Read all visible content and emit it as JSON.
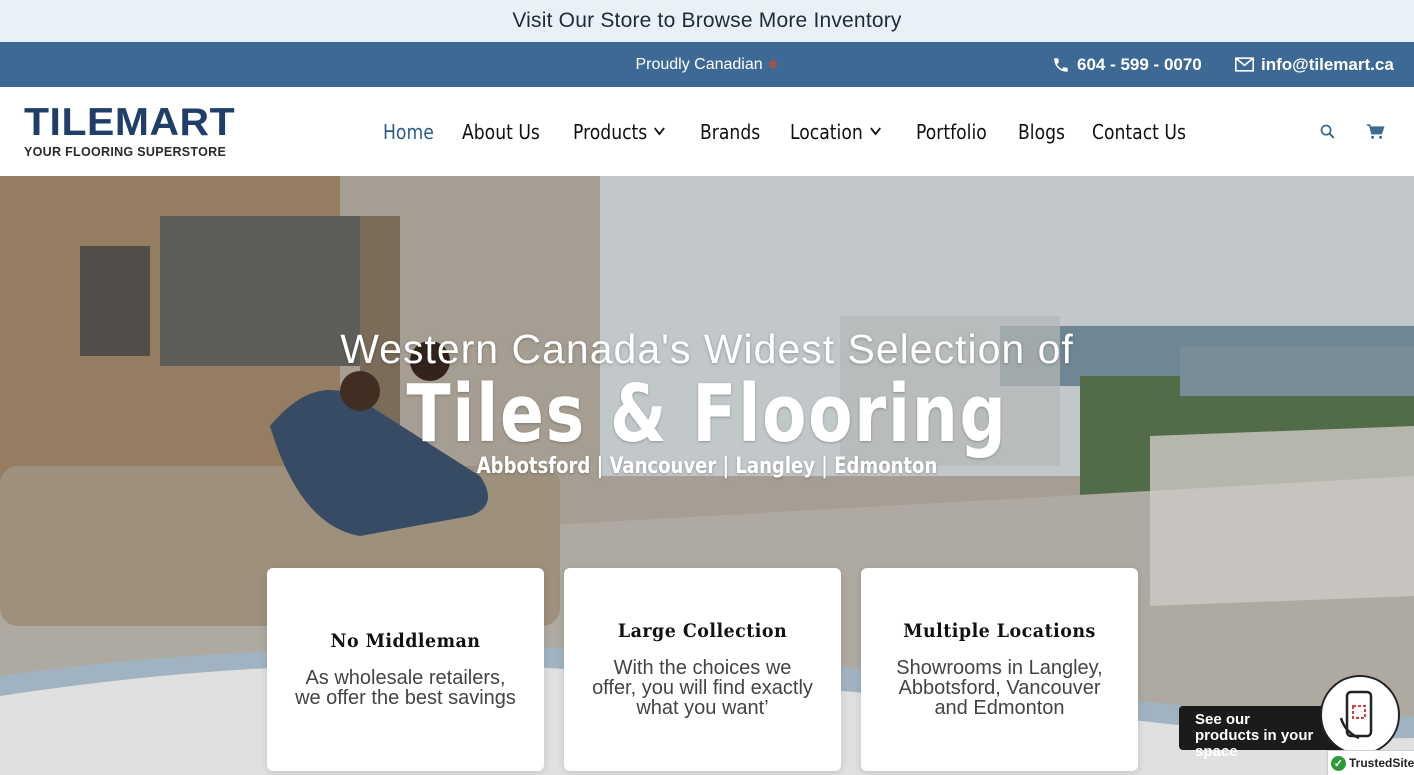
{
  "announcement": {
    "text": "Visit Our Store to Browse More Inventory"
  },
  "topbar": {
    "tagline": "Proudly Canadian",
    "phone": "604 - 599 - 0070",
    "email": "info@tilemart.ca",
    "bg_color": "#3d6a94"
  },
  "logo": {
    "brand": "TILEMART",
    "tagline": "YOUR FLOORING SUPERSTORE"
  },
  "nav": {
    "items": [
      {
        "label": "Home",
        "active": true
      },
      {
        "label": "About Us"
      },
      {
        "label": "Products",
        "dropdown": true
      },
      {
        "label": "Brands"
      },
      {
        "label": "Location",
        "dropdown": true
      },
      {
        "label": "Portfolio"
      },
      {
        "label": "Blogs"
      },
      {
        "label": "Contact Us"
      }
    ],
    "active_color": "#2b5d8c"
  },
  "header_icons": [
    "search-icon",
    "cart-icon"
  ],
  "hero": {
    "subtitle": "Western Canada's Widest Selection of",
    "title": "Tiles & Flooring",
    "locations": "Abbotsford | Vancouver | Langley | Edmonton"
  },
  "features": [
    {
      "title": "No Middleman",
      "text": "As wholesale retailers, we offer the best savings"
    },
    {
      "title": "Large Collection",
      "text": "With the choices we offer, you will find exactly what you want’"
    },
    {
      "title": "Multiple Locations",
      "text": "Showrooms in Langley, Abbotsford, Vancouver and Edmonton"
    }
  ],
  "ar_widget": {
    "label": "See our products in your space"
  },
  "trusted": {
    "label": "TrustedSite"
  }
}
